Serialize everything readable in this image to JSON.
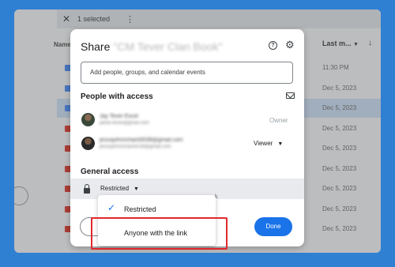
{
  "drive": {
    "selection_count": "1 selected",
    "column_name": "Name",
    "column_last_modified": "Last m...",
    "rows": [
      {
        "date": "11:30 PM",
        "type": "doc",
        "selected": false
      },
      {
        "date": "Dec 5, 2023",
        "type": "doc",
        "selected": false
      },
      {
        "date": "Dec 5, 2023",
        "type": "doc",
        "selected": true
      },
      {
        "date": "Dec 5, 2023",
        "type": "sheet",
        "selected": false
      },
      {
        "date": "Dec 5, 2023",
        "type": "sheet",
        "selected": false
      },
      {
        "date": "Dec 5, 2023",
        "type": "sheet",
        "selected": false
      },
      {
        "date": "Dec 5, 2023",
        "type": "sheet",
        "selected": false
      },
      {
        "date": "Dec 5, 2023",
        "type": "sheet",
        "selected": false
      },
      {
        "date": "Dec 5, 2023",
        "type": "sheet",
        "selected": false
      }
    ]
  },
  "dialog": {
    "title": "Share",
    "file_name": "\"CM Tever Clan Book\"",
    "help_icon": "?",
    "add_people_placeholder": "Add people, groups, and calendar events",
    "people_with_access_heading": "People with access",
    "people": [
      {
        "name": "Jay Tever Excel",
        "email": "jamie.tever@gmail.com",
        "role": "Owner"
      },
      {
        "name": "jesusjohnrichard3038@gmail.com",
        "email": "jesusjohnrichard3038@gmail.com",
        "role": "Viewer"
      }
    ],
    "general_access_heading": "General access",
    "general_access_value": "Restricted",
    "general_access_suffix": "k",
    "done_label": "Done"
  },
  "access_menu": {
    "options": [
      "Restricted",
      "Anyone with the link"
    ],
    "selected": "Restricted"
  },
  "colors": {
    "background": "#2f7fd3",
    "accent": "#1a73e8",
    "highlight": "#e0282e"
  }
}
